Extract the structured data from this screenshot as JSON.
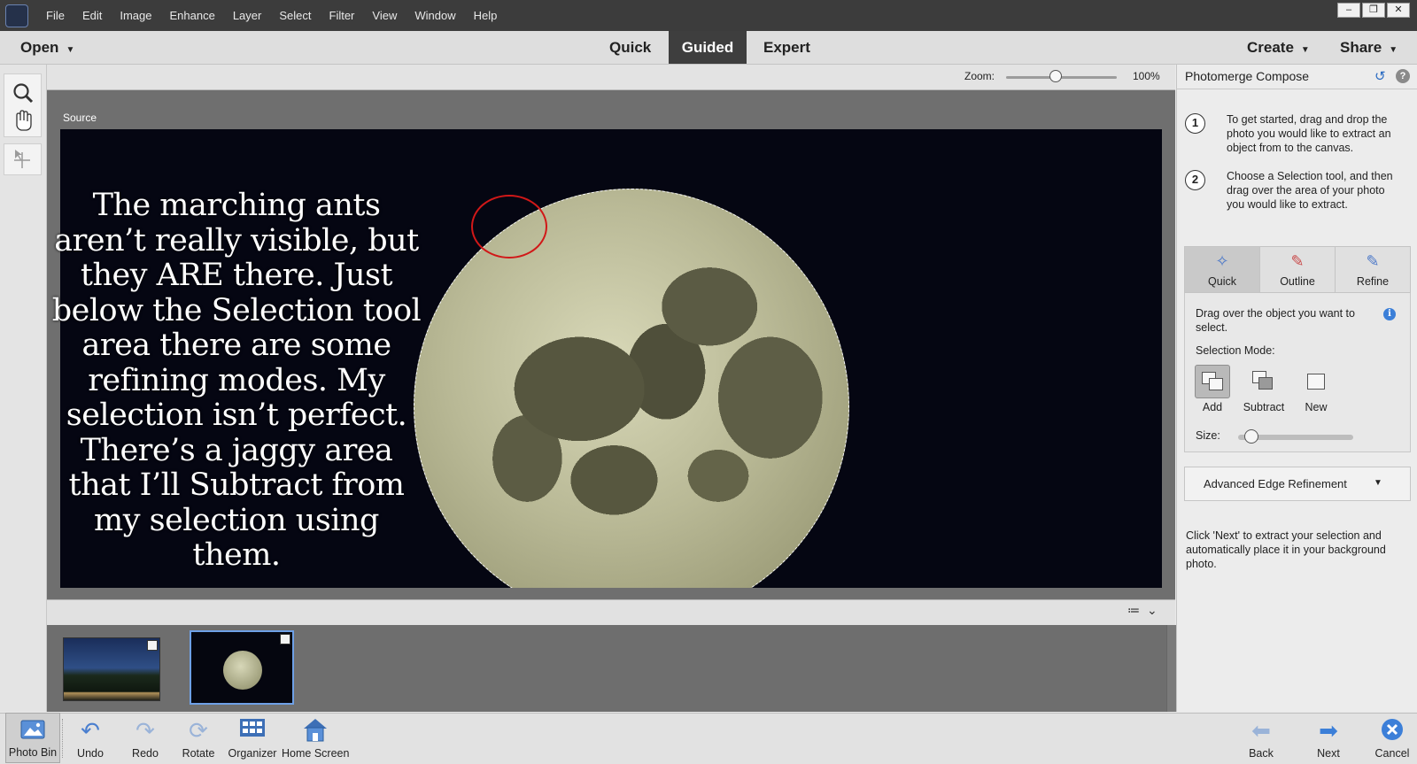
{
  "menubar": {
    "items": [
      "File",
      "Edit",
      "Image",
      "Enhance",
      "Layer",
      "Select",
      "Filter",
      "View",
      "Window",
      "Help"
    ]
  },
  "modebar": {
    "open_label": "Open",
    "tabs": [
      "Quick",
      "Guided",
      "Expert"
    ],
    "active_tab": "Guided",
    "create_label": "Create",
    "share_label": "Share"
  },
  "zoom": {
    "label": "Zoom:",
    "value": "100%",
    "level": 0.45
  },
  "canvas": {
    "source_label": "Source",
    "overlay_text": "The marching ants aren’t really visible, but they ARE there. Just below the Selection tool area there are some refining modes. My selection isn’t perfect. There’s a jaggy area that I’ll Subtract from my selection using them."
  },
  "panel": {
    "title": "Photomerge Compose",
    "steps": [
      {
        "num": "1",
        "text": "To get started, drag and drop the photo you would like to extract an object from to the canvas."
      },
      {
        "num": "2",
        "text": "Choose a Selection tool, and then drag over the area of your photo you would like to extract."
      }
    ],
    "tool_tabs": [
      {
        "label": "Quick",
        "icon": "quick-selection-icon"
      },
      {
        "label": "Outline",
        "icon": "outline-brush-icon"
      },
      {
        "label": "Refine",
        "icon": "refine-brush-icon"
      }
    ],
    "active_tool": "Quick",
    "quick_description": "Drag over the object you want to select.",
    "selection_mode_label": "Selection Mode:",
    "modes": [
      "Add",
      "Subtract",
      "New"
    ],
    "active_mode": "Add",
    "size_label": "Size:",
    "size_level": 0.05,
    "advanced_label": "Advanced Edge Refinement",
    "next_note": "Click 'Next' to extract your selection and automatically place it in your background photo."
  },
  "bottombar": {
    "photo_bin": "Photo Bin",
    "undo": "Undo",
    "redo": "Redo",
    "rotate": "Rotate",
    "organizer": "Organizer",
    "home_screen": "Home Screen",
    "back": "Back",
    "next": "Next",
    "cancel": "Cancel"
  },
  "colors": {
    "accent_blue": "#3b7fd8",
    "guided_tab_bg": "#3e3e3e",
    "annotation_red": "#d11818",
    "photo_bg": "#050612"
  }
}
